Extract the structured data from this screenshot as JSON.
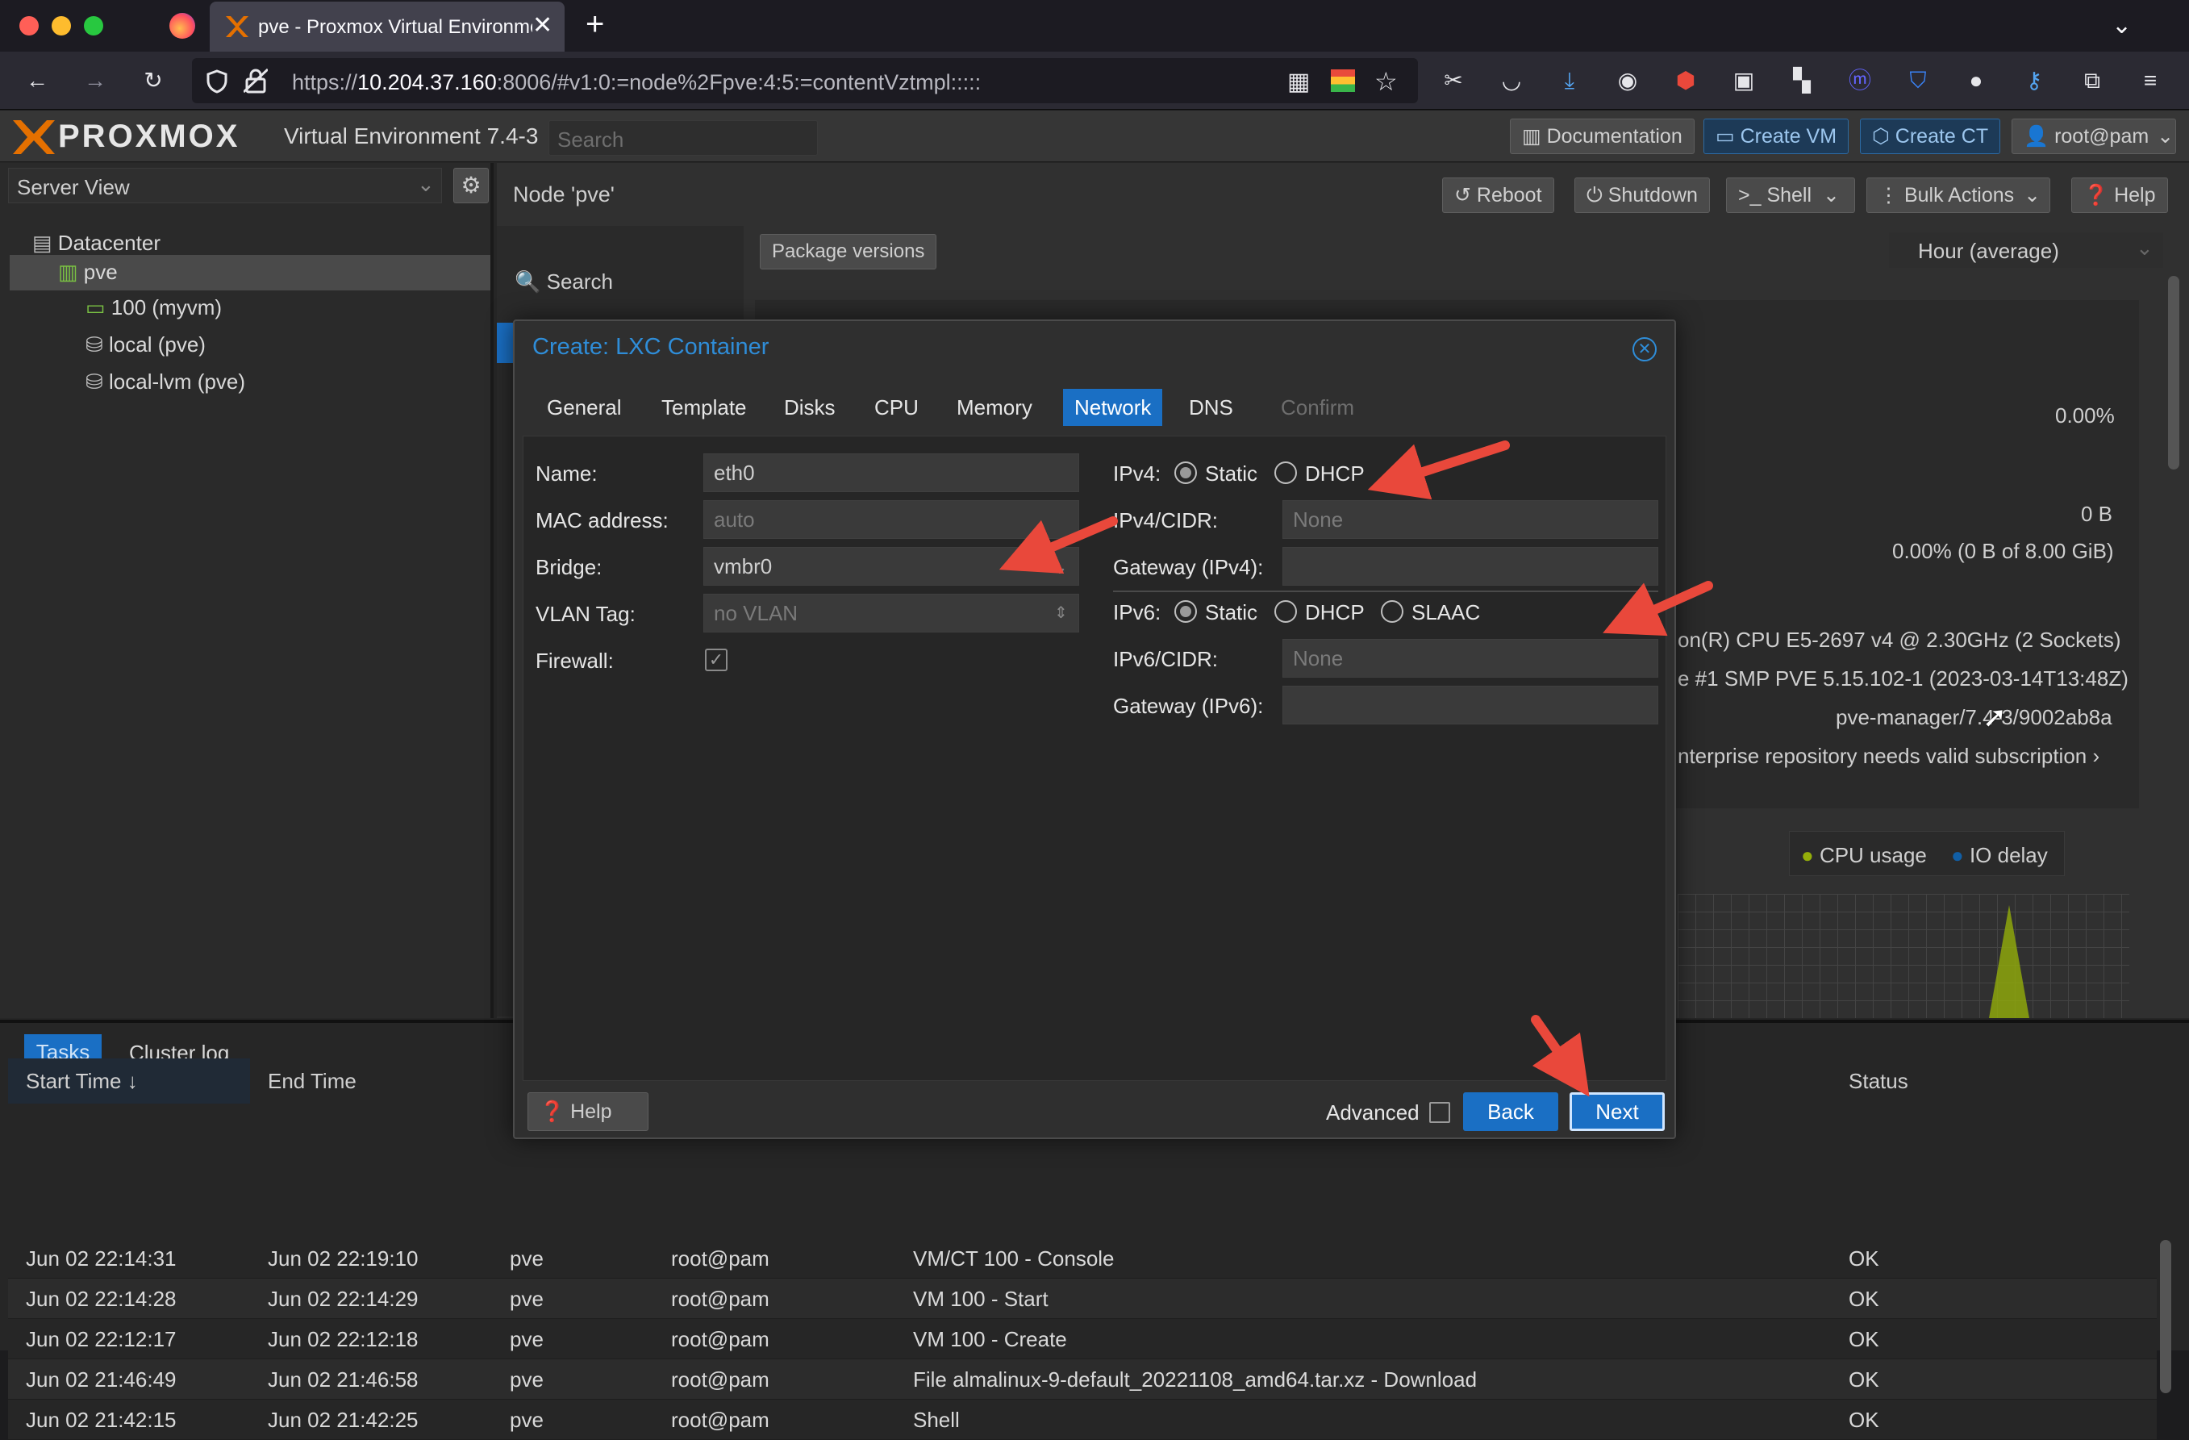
{
  "browser": {
    "tab_title": "pve - Proxmox Virtual Environme",
    "url_prefix": "https://",
    "url_host": "10.204.37.160",
    "url_rest": ":8006/#v1:0:=node%2Fpve:4:5:=contentVztmpl:::::"
  },
  "header": {
    "logo": "PROXMOX",
    "product": "Virtual Environment 7.4-3",
    "search_placeholder": "Search",
    "documentation": "Documentation",
    "create_vm": "Create VM",
    "create_ct": "Create CT",
    "user": "root@pam"
  },
  "sidebar": {
    "view": "Server View",
    "items": [
      {
        "label": "Datacenter"
      },
      {
        "label": "pve"
      },
      {
        "label": "100 (myvm)"
      },
      {
        "label": "local (pve)"
      },
      {
        "label": "local-lvm (pve)"
      }
    ]
  },
  "node": {
    "title": "Node 'pve'",
    "reboot": "Reboot",
    "shutdown": "Shutdown",
    "shell": "Shell",
    "bulk_actions": "Bulk Actions",
    "help": "Help",
    "search": "Search",
    "package_versions": "Package versions",
    "timeframe": "Hour (average)",
    "cpu_pct": "0.00%",
    "swap": "0 B",
    "rootfs": "0.00% (0 B of 8.00 GiB)",
    "cpu_model": "on(R) CPU E5-2697 v4 @ 2.30GHz (2 Sockets)",
    "kernel": "e #1 SMP PVE 5.15.102-1 (2023-03-14T13:48Z)",
    "manager": "pve-manager/7.4-3/9002ab8a",
    "repo": "nterprise repository needs valid subscription",
    "legend_cpu": "CPU usage",
    "legend_io": "IO delay"
  },
  "modal": {
    "title": "Create: LXC Container",
    "tabs": [
      "General",
      "Template",
      "Disks",
      "CPU",
      "Memory",
      "Network",
      "DNS",
      "Confirm"
    ],
    "name_label": "Name:",
    "name_value": "eth0",
    "mac_label": "MAC address:",
    "mac_value": "auto",
    "bridge_label": "Bridge:",
    "bridge_value": "vmbr0",
    "vlan_label": "VLAN Tag:",
    "vlan_value": "no VLAN",
    "firewall_label": "Firewall:",
    "firewall_checked": true,
    "ipv4_label": "IPv4:",
    "ipv4_static": "Static",
    "ipv4_dhcp": "DHCP",
    "ipv4_cidr_label": "IPv4/CIDR:",
    "ipv4_cidr_value": "None",
    "gw4_label": "Gateway (IPv4):",
    "ipv6_label": "IPv6:",
    "ipv6_static": "Static",
    "ipv6_dhcp": "DHCP",
    "ipv6_slaac": "SLAAC",
    "ipv6_cidr_label": "IPv6/CIDR:",
    "ipv6_cidr_value": "None",
    "gw6_label": "Gateway (IPv6):",
    "help": "Help",
    "advanced": "Advanced",
    "back": "Back",
    "next": "Next"
  },
  "tasks": {
    "tabs": [
      "Tasks",
      "Cluster log"
    ],
    "columns": [
      "Start Time",
      "End Time",
      "Status"
    ],
    "rows": [
      {
        "start": "Jun 02 22:14:31",
        "end": "Jun 02 22:19:10",
        "node": "pve",
        "user": "root@pam",
        "desc": "VM/CT 100 - Console",
        "status": "OK"
      },
      {
        "start": "Jun 02 22:14:28",
        "end": "Jun 02 22:14:29",
        "node": "pve",
        "user": "root@pam",
        "desc": "VM 100 - Start",
        "status": "OK"
      },
      {
        "start": "Jun 02 22:12:17",
        "end": "Jun 02 22:12:18",
        "node": "pve",
        "user": "root@pam",
        "desc": "VM 100 - Create",
        "status": "OK"
      },
      {
        "start": "Jun 02 21:46:49",
        "end": "Jun 02 21:46:58",
        "node": "pve",
        "user": "root@pam",
        "desc": "File almalinux-9-default_20221108_amd64.tar.xz - Download",
        "status": "OK"
      },
      {
        "start": "Jun 02 21:42:15",
        "end": "Jun 02 21:42:25",
        "node": "pve",
        "user": "root@pam",
        "desc": "Shell",
        "status": "OK"
      }
    ]
  },
  "colors": {
    "accent": "#2f8dd8",
    "arrow": "#e9483b",
    "active_tab": "#1a6fc4"
  }
}
